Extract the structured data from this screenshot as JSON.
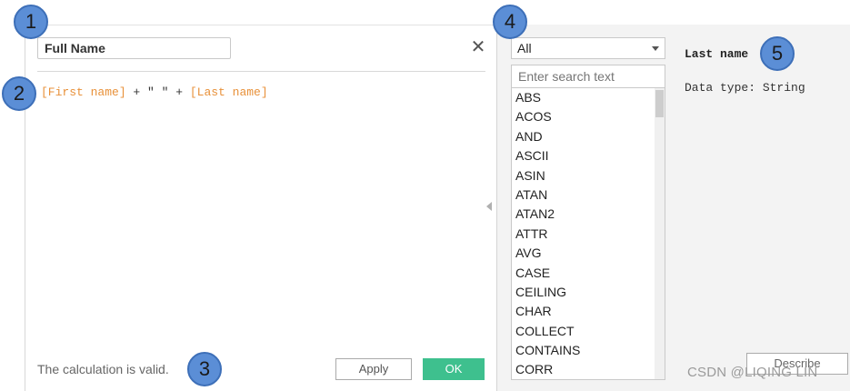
{
  "calculation": {
    "name": "Full Name",
    "formula": {
      "field1": "[First name]",
      "op1": " + ",
      "literal": "\" \"",
      "op2": " + ",
      "field2": "[Last name]"
    },
    "status": "The calculation is valid.",
    "apply_label": "Apply",
    "ok_label": "OK"
  },
  "functions": {
    "filter_value": "All",
    "search_placeholder": "Enter search text",
    "items": [
      "ABS",
      "ACOS",
      "AND",
      "ASCII",
      "ASIN",
      "ATAN",
      "ATAN2",
      "ATTR",
      "AVG",
      "CASE",
      "CEILING",
      "CHAR",
      "COLLECT",
      "CONTAINS",
      "CORR"
    ]
  },
  "help": {
    "title": "Last name",
    "data_type": "Data type: String",
    "describe_label": "Describe"
  },
  "badges": [
    "1",
    "2",
    "3",
    "4",
    "5"
  ],
  "watermark": "CSDN @LIQING LIN",
  "colors": {
    "accent_ok": "#3ec08e",
    "field_ref": "#e8913a",
    "badge": "#5b8ed6"
  }
}
